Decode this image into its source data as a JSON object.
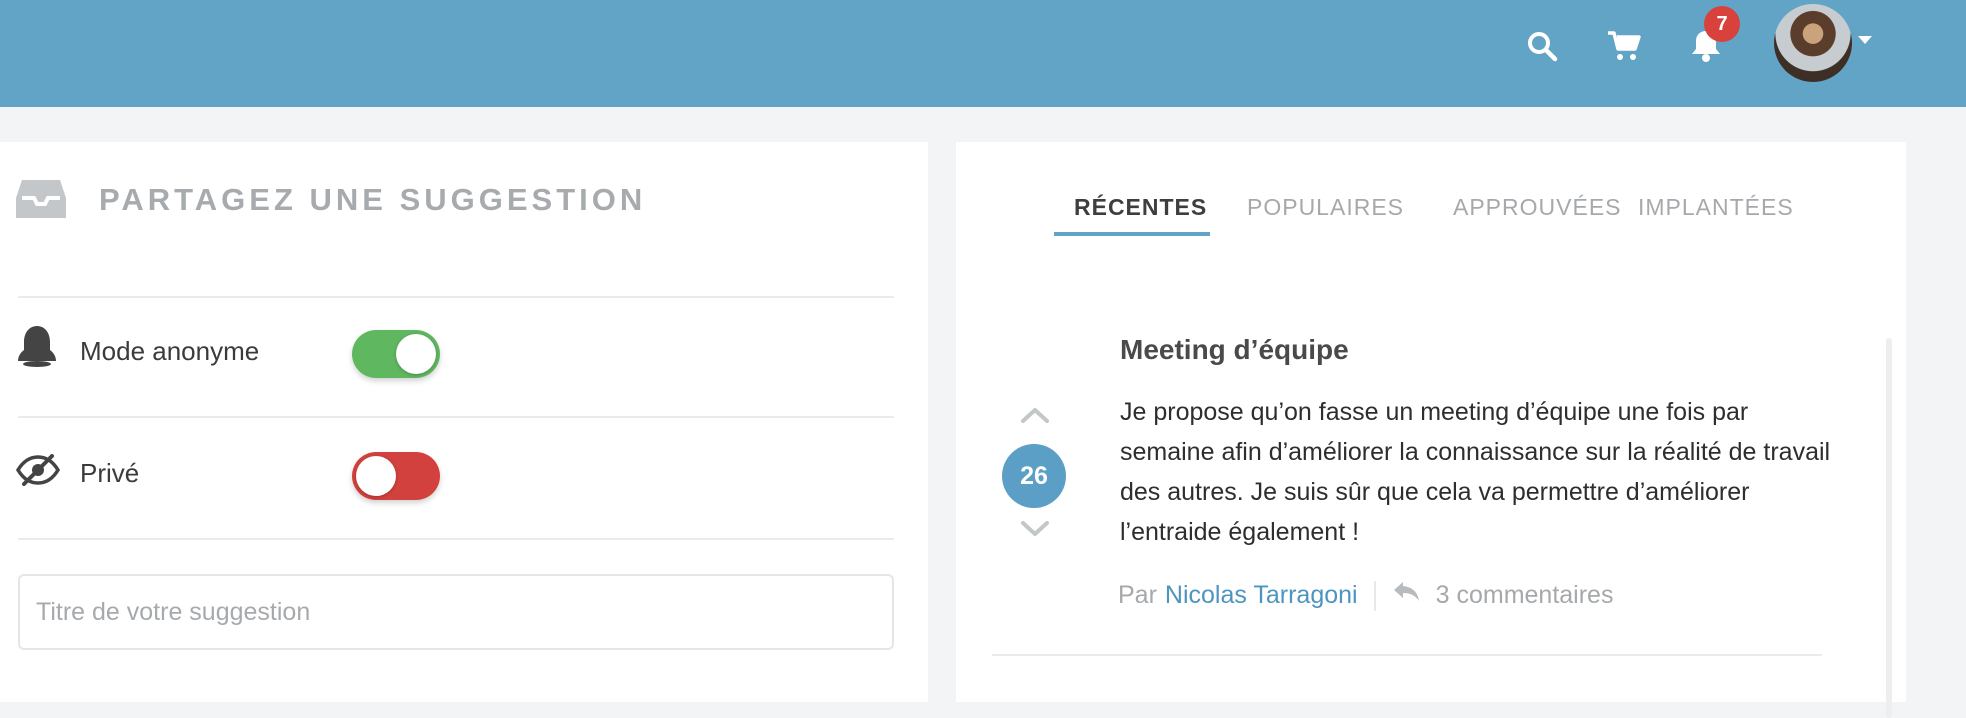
{
  "header": {
    "notification_count": "7",
    "icons": [
      "search-icon",
      "cart-icon",
      "bell-icon",
      "avatar",
      "chevron-down-icon"
    ]
  },
  "share": {
    "title": "PARTAGEZ UNE SUGGESTION",
    "anonymous_label": "Mode anonyme",
    "anonymous_on": true,
    "private_label": "Privé",
    "private_on": false,
    "title_placeholder": "Titre de votre suggestion",
    "title_value": ""
  },
  "tabs": [
    {
      "label": "RÉCENTES",
      "active": true
    },
    {
      "label": "POPULAIRES",
      "active": false
    },
    {
      "label": "APPROUVÉES",
      "active": false
    },
    {
      "label": "IMPLANTÉES",
      "active": false
    }
  ],
  "post": {
    "title": "Meeting d’équipe",
    "body": "Je propose qu’on fasse un meeting d’équipe une fois par semaine afin d’améliorer la connaissance sur la réalité de travail des autres. Je suis sûr que cela va permettre d’améliorer l’entraide également !",
    "votes": "26",
    "by_label": "Par",
    "author": "Nicolas Tarragoni",
    "comments": "3 commentaires"
  },
  "colors": {
    "header": "#62a4c6",
    "toggle_on": "#5fb760",
    "toggle_off": "#d2413d",
    "badge": "#d9413d",
    "accent": "#5c9fc6"
  }
}
